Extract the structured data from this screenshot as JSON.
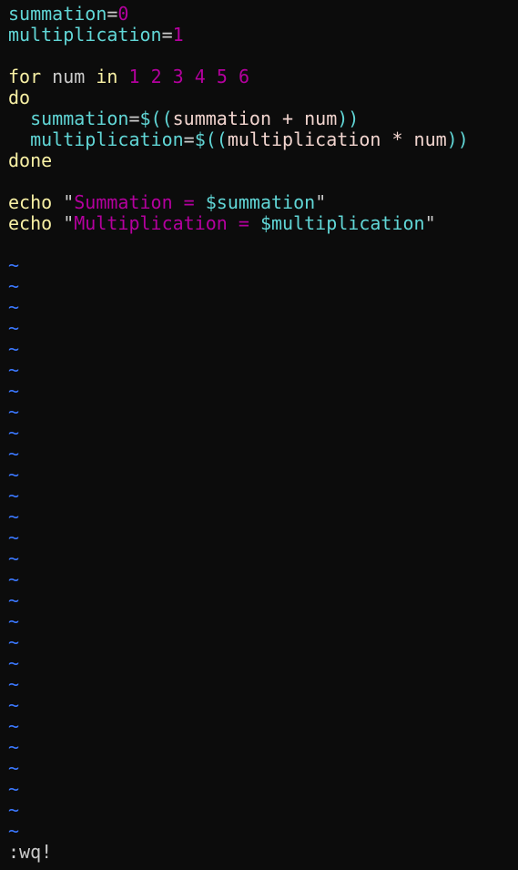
{
  "colors": {
    "background": "#0c0c0c",
    "variable": "#61d6d6",
    "number": "#b4009e",
    "keyword": "#f9f1a5",
    "plain": "#cccccc",
    "expr_var": "#f2d5cf",
    "paren": "#3b9dff",
    "tilde": "#3b78ff"
  },
  "lines": [
    [
      {
        "text": "summation",
        "c": "variable"
      },
      {
        "text": "=",
        "c": "plain"
      },
      {
        "text": "0",
        "c": "number"
      }
    ],
    [
      {
        "text": "multiplication",
        "c": "variable"
      },
      {
        "text": "=",
        "c": "plain"
      },
      {
        "text": "1",
        "c": "number"
      }
    ],
    [],
    [
      {
        "text": "for",
        "c": "keyword"
      },
      {
        "text": " num ",
        "c": "plain"
      },
      {
        "text": "in",
        "c": "keyword"
      },
      {
        "text": " ",
        "c": "plain"
      },
      {
        "text": "1",
        "c": "number"
      },
      {
        "text": " ",
        "c": "plain"
      },
      {
        "text": "2",
        "c": "number"
      },
      {
        "text": " ",
        "c": "plain"
      },
      {
        "text": "3",
        "c": "number"
      },
      {
        "text": " ",
        "c": "plain"
      },
      {
        "text": "4",
        "c": "number"
      },
      {
        "text": " ",
        "c": "plain"
      },
      {
        "text": "5",
        "c": "number"
      },
      {
        "text": " ",
        "c": "plain"
      },
      {
        "text": "6",
        "c": "number"
      }
    ],
    [
      {
        "text": "do",
        "c": "keyword"
      }
    ],
    [
      {
        "text": "  ",
        "c": "plain"
      },
      {
        "text": "summation",
        "c": "variable"
      },
      {
        "text": "=",
        "c": "plain"
      },
      {
        "text": "$((",
        "c": "variable"
      },
      {
        "text": "summation + num",
        "c": "expr_var"
      },
      {
        "text": "))",
        "c": "variable"
      }
    ],
    [
      {
        "text": "  ",
        "c": "plain"
      },
      {
        "text": "multiplication",
        "c": "variable"
      },
      {
        "text": "=",
        "c": "plain"
      },
      {
        "text": "$((",
        "c": "variable"
      },
      {
        "text": "multiplication * num",
        "c": "expr_var"
      },
      {
        "text": "))",
        "c": "variable"
      }
    ],
    [
      {
        "text": "done",
        "c": "keyword"
      }
    ],
    [],
    [
      {
        "text": "echo",
        "c": "keyword"
      },
      {
        "text": " ",
        "c": "plain"
      },
      {
        "text": "\"",
        "c": "plain"
      },
      {
        "text": "Summation = ",
        "c": "number"
      },
      {
        "text": "$summation",
        "c": "variable"
      },
      {
        "text": "\"",
        "c": "plain"
      }
    ],
    [
      {
        "text": "echo",
        "c": "keyword"
      },
      {
        "text": " ",
        "c": "plain"
      },
      {
        "text": "\"",
        "c": "plain"
      },
      {
        "text": "Multiplication = ",
        "c": "number"
      },
      {
        "text": "$multiplication",
        "c": "variable"
      },
      {
        "text": "\"",
        "c": "plain"
      }
    ],
    []
  ],
  "empty_line_marker": "~",
  "empty_line_count": 28,
  "command_line": ":wq!"
}
